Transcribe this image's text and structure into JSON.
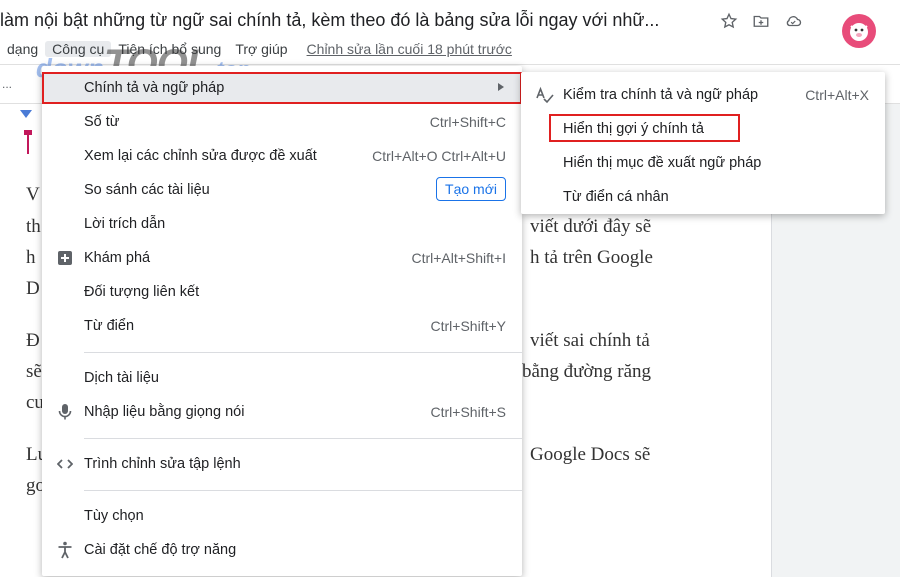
{
  "header": {
    "title": "làm nội bật những từ ngữ sai chính tả, kèm theo đó là bảng sửa lỗi ngay với nhữ...",
    "icons": [
      "star-icon",
      "move-to-folder-icon",
      "cloud-status-icon"
    ],
    "avatar": "avatar-icon"
  },
  "menubar": {
    "items": [
      "dạng",
      "Công cụ",
      "Tiện ích bổ sung",
      "Trợ giúp"
    ],
    "last_edit": "Chỉnh sửa lần cuối 18 phút trước"
  },
  "toolbar": {
    "left_text": "..."
  },
  "watermark": {
    "part1": "down",
    "part2": "TOOL",
    "part3": ".top"
  },
  "document": {
    "lines": [
      {
        "text": "V"
      },
      {
        "text": "th",
        "right": "viết dưới đây sẽ"
      },
      {
        "text": "h",
        "right": "h tả trên Google"
      },
      {
        "text": "D"
      },
      {
        "text": "Đ",
        "right": "viết sai chính tả"
      },
      {
        "text": "sẽ",
        "right": "bằng đường răng"
      },
      {
        "text": "cư"
      },
      {
        "text": "Lư",
        "right": "Google Docs sẽ"
      },
      {
        "text": "gơ"
      }
    ]
  },
  "tools_menu": {
    "items": [
      {
        "label": "Chính tả và ngữ pháp",
        "shortcut": "",
        "icon": "",
        "submenu": true
      },
      {
        "label": "Số từ",
        "shortcut": "Ctrl+Shift+C"
      },
      {
        "label": "Xem lại các chỉnh sửa được đề xuất",
        "shortcut": "Ctrl+Alt+O Ctrl+Alt+U"
      },
      {
        "label": "So sánh các tài liệu",
        "badge": "Tạo mới"
      },
      {
        "label": "Lời trích dẫn",
        "shortcut": ""
      },
      {
        "label": "Khám phá",
        "shortcut": "Ctrl+Alt+Shift+I",
        "icon": "explore-plus-icon"
      },
      {
        "label": "Đối tượng liên kết",
        "shortcut": ""
      },
      {
        "label": "Từ điển",
        "shortcut": "Ctrl+Shift+Y"
      },
      {
        "label": "Dịch tài liệu",
        "shortcut": ""
      },
      {
        "label": "Nhập liệu bằng giọng nói",
        "shortcut": "Ctrl+Shift+S",
        "icon": "microphone-icon"
      },
      {
        "label": "Trình chỉnh sửa tập lệnh",
        "shortcut": "",
        "icon": "code-icon"
      },
      {
        "label": "Tùy chọn",
        "shortcut": ""
      },
      {
        "label": "Cài đặt chế độ trợ năng",
        "shortcut": "",
        "icon": "accessibility-icon"
      }
    ]
  },
  "spelling_submenu": {
    "items": [
      {
        "label": "Kiểm tra chính tả và ngữ pháp",
        "shortcut": "Ctrl+Alt+X",
        "icon": "spellcheck-icon"
      },
      {
        "label": "Hiển thị gợi ý chính tả",
        "shortcut": ""
      },
      {
        "label": "Hiển thị mục đề xuất ngữ pháp",
        "shortcut": ""
      },
      {
        "label": "Từ điển cá nhân",
        "shortcut": ""
      }
    ]
  },
  "colors": {
    "highlight_border": "#e02020",
    "accent": "#1a73e8",
    "menu_hover": "#e8eaed"
  }
}
